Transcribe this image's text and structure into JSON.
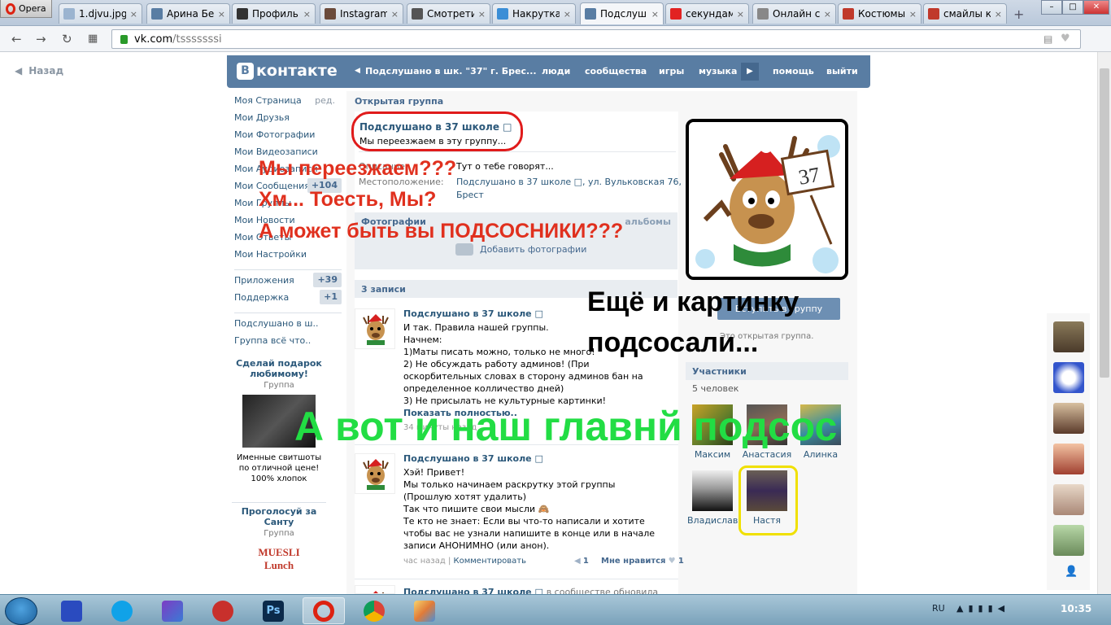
{
  "browser": {
    "name": "Opera",
    "tabs": [
      {
        "label": "1.djvu.jpg",
        "fav": "#9bb4d0"
      },
      {
        "label": "Арина Бе",
        "fav": "#597da3"
      },
      {
        "label": "Профиль",
        "fav": "#333333"
      },
      {
        "label": "Instagram",
        "fav": "#6b4b3b"
      },
      {
        "label": "Смотрети",
        "fav": "#555555"
      },
      {
        "label": "Накрутка",
        "fav": "#3b8ed6"
      },
      {
        "label": "Подслуш",
        "fav": "#597da3"
      },
      {
        "label": "секундам",
        "fav": "#e22222"
      },
      {
        "label": "Онлайн с",
        "fav": "#888888"
      },
      {
        "label": "Костюмы",
        "fav": "#c0392b"
      },
      {
        "label": "смайлы к",
        "fav": "#c0392b"
      }
    ],
    "active_tab": 6,
    "url_domain": "vk.com",
    "url_path": "/tsssssssi",
    "tab_close": "×",
    "new_tab": "+"
  },
  "page": {
    "back": "Назад",
    "logo_letter": "В",
    "logo_text": "контакте",
    "nav": {
      "group": "Подслушано в шк. \"37\" г. Брес...",
      "people": "люди",
      "communities": "сообщества",
      "games": "игры",
      "music": "музыка",
      "help": "помощь",
      "logout": "выйти"
    },
    "menu": [
      {
        "label": "Моя Страница",
        "extra": "ред."
      },
      {
        "label": "Мои Друзья",
        "extra": ""
      },
      {
        "label": "Мои Фотографии",
        "extra": ""
      },
      {
        "label": "Мои Видеозаписи",
        "extra": ""
      },
      {
        "label": "Мои Аудиозаписи",
        "extra": ""
      },
      {
        "label": "Мои Сообщения",
        "extra": "+104"
      },
      {
        "label": "Мои Группы",
        "extra": ""
      },
      {
        "label": "Мои Новости",
        "extra": ""
      },
      {
        "label": "Мои Ответы",
        "extra": ""
      },
      {
        "label": "Мои Настройки",
        "extra": ""
      }
    ],
    "menu2": [
      {
        "label": "Приложения",
        "extra": "+39"
      },
      {
        "label": "Поддержка",
        "extra": "+1"
      }
    ],
    "menu3": [
      "Подслушано в ш..",
      "Группа всё что.."
    ],
    "ads": [
      {
        "title": "Сделай подарок любимому!",
        "sub": "Группа",
        "text": "Именные свитшоты по отличной цене! 100% хлопок"
      },
      {
        "title": "Проголосуй за Санту",
        "sub": "Группа",
        "text": "MUESLI Lunch"
      }
    ],
    "group_type": "Открытая группа",
    "group_name": "Подслушано в 37 школе □",
    "group_status": "Мы переезжаем в эту группу...",
    "info": [
      {
        "k": "Описание:",
        "v": "Тут о тебе говорят..."
      },
      {
        "k": "Местоположение:",
        "v": "Подслушано в 37 школе □, ул. Вульковская 76,"
      },
      {
        "k": "",
        "v": "Брест"
      }
    ],
    "photos_head": "Фотографии",
    "albums": "альбомы",
    "add_photo": "Добавить фотографии",
    "posts_head": "3 записи",
    "posts": [
      {
        "author": "Подслушано в 37 школе □",
        "lines": [
          "И так. Правила нашей группы.",
          "Начнем:",
          "1)Маты писать можно, только не много!",
          "2) Не обсуждать работу админов! (При оскорбительных словах в сторону админов бан на определенное колличество дней)",
          "3) Не присылать не культурные картинки!"
        ],
        "more": "Показать полностью..",
        "meta": "34 минуты назад"
      },
      {
        "author": "Подслушано в 37 школе □",
        "lines": [
          "Хэй! Привет!",
          "Мы только начинаем раскрутку этой группы (Прошлую хотят удалить)",
          "Так что пишите свои мысли 🙈",
          "Те кто не знает: Если вы что-то написали и хотите чтобы вас не узнали напишите в конце или в начале записи АНОНИМНО (или анон)."
        ],
        "meta": "час назад",
        "comment": "Комментировать",
        "reposts": "1",
        "likes_label": "Мне нравится",
        "likes": "1"
      },
      {
        "author": "Подслушано в 37 школе □",
        "suffix": "в сообществе обновила"
      }
    ],
    "join": "Вступить в группу",
    "open_group_note": "Это открытая группа.",
    "members_head": "Участники",
    "members_count": "5 человек",
    "members": [
      "Максим",
      "Анастасия",
      "Алинка",
      "Владислав",
      "Настя"
    ],
    "avatar_text": "37"
  },
  "captions": {
    "c1": "Мы переезжаем???",
    "c2": "Хм... Тоесть, Мы?",
    "c3": "А может быть вы ПОДСОСНИКИ???",
    "c4a": "Ещё и картинку",
    "c4b": "подсосали...",
    "c5": "А вот и наш главнй подсос"
  },
  "taskbar": {
    "lang": "RU",
    "time": "10:35"
  },
  "colors": {
    "vk_blue": "#597da3",
    "red_caption": "#e0301e",
    "green_caption": "#22dd44",
    "oval": "#e01b1b",
    "highlight": "#f0e000"
  }
}
